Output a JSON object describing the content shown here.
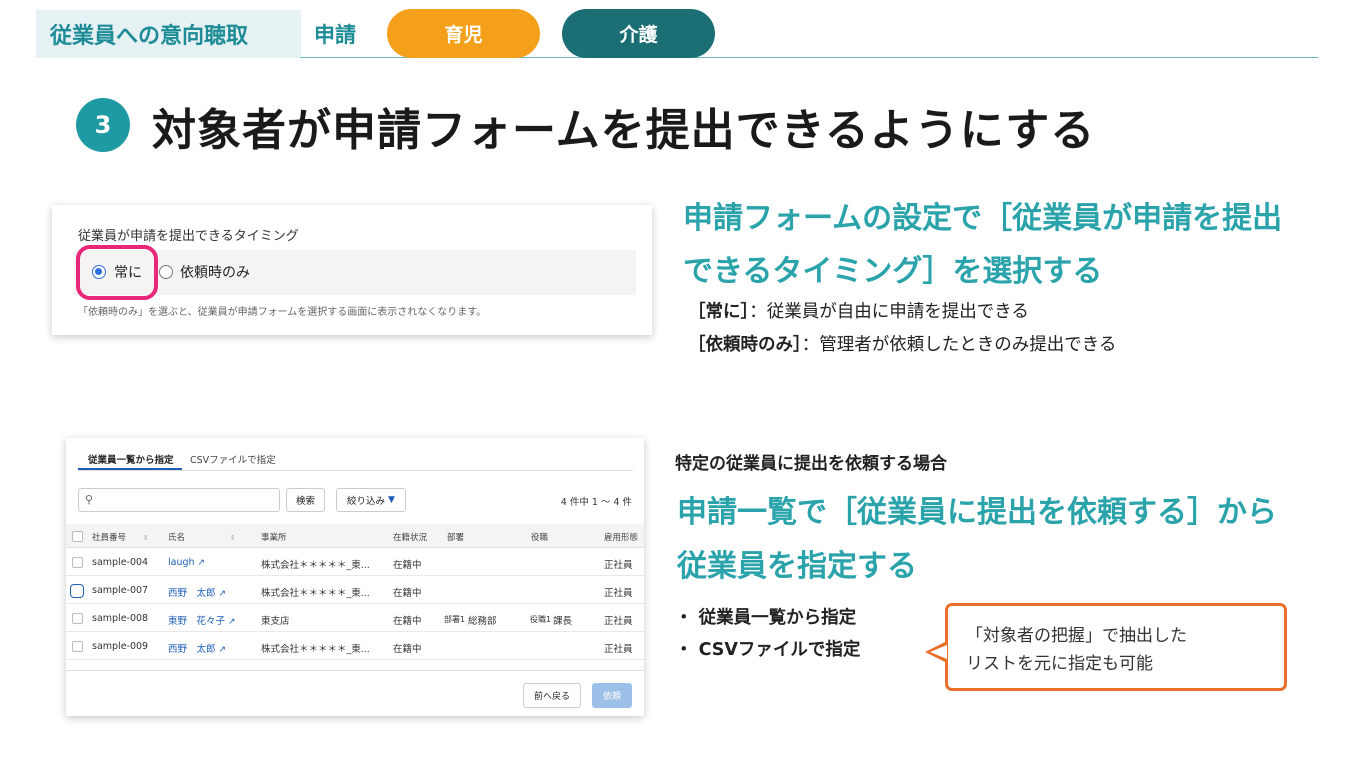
{
  "header": {
    "section_label": "従業員への意向聴取",
    "category": "申請",
    "tab_childcare": "育児",
    "tab_care": "介護"
  },
  "title": {
    "step_number": "3",
    "text": "対象者が申請フォームを提出できるようにする"
  },
  "timing_panel": {
    "heading": "従業員が申請を提出できるタイミング",
    "option_always": "常に",
    "option_on_request": "依頼時のみ",
    "selected": "常に",
    "note": "「依頼時のみ」を選ぶと、従業員が申請フォームを選択する画面に表示されなくなります。"
  },
  "timing_explanation": {
    "headline": "申請フォームの設定で［従業員が申請を提出できるタイミング］を選択する",
    "line1_term": "［常に］",
    "line1_desc": "：従業員が自由に申請を提出できる",
    "line2_term": "［依頼時のみ］",
    "line2_desc": "：管理者が依頼したときのみ提出できる"
  },
  "employee_panel": {
    "tab_list": "従業員一覧から指定",
    "tab_csv": "CSVファイルで指定",
    "search_placeholder": "",
    "search_button": "検索",
    "filter_button": "絞り込み",
    "count": "4 件中 1 〜 4 件",
    "columns": [
      "社員番号",
      "氏名",
      "事業所",
      "在籍状況",
      "部署",
      "役職",
      "雇用形態"
    ],
    "rows": [
      {
        "id": "sample-004",
        "name": "laugh",
        "office": "株式会社＊＊＊＊＊_東...",
        "status": "在籍中",
        "dept_label": "",
        "dept": "",
        "role_label": "",
        "role": "",
        "type": "正社員"
      },
      {
        "id": "sample-007",
        "name": "西野　太郎",
        "office": "株式会社＊＊＊＊＊_東...",
        "status": "在籍中",
        "dept_label": "",
        "dept": "",
        "role_label": "",
        "role": "",
        "type": "正社員"
      },
      {
        "id": "sample-008",
        "name": "東野　花々子",
        "office": "東支店",
        "status": "在籍中",
        "dept_label": "部署1",
        "dept": "総務部",
        "role_label": "役職1",
        "role": "課長",
        "type": "正社員"
      },
      {
        "id": "sample-009",
        "name": "西野　太郎",
        "office": "株式会社＊＊＊＊＊_東...",
        "status": "在籍中",
        "dept_label": "",
        "dept": "",
        "role_label": "",
        "role": "",
        "type": "正社員"
      }
    ],
    "back_button": "前へ戻る",
    "request_button": "依頼"
  },
  "request_explanation": {
    "subheading": "特定の従業員に提出を依頼する場合",
    "headline": "申請一覧で［従業員に提出を依頼する］から従業員を指定する",
    "bullet1": "・ 従業員一覧から指定",
    "bullet2": "・ CSVファイルで指定"
  },
  "callout": {
    "line1": "「対象者の把握」で抽出した",
    "line2": "リストを元に指定も可能"
  },
  "colors": {
    "teal": "#2aa3ab",
    "dark_teal": "#1b6f74",
    "orange": "#f5a01a",
    "callout_border": "#e8702a",
    "highlight": "#e8267a"
  }
}
